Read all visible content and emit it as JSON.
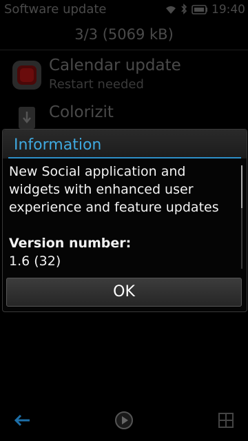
{
  "statusbar": {
    "title": "Software update",
    "time": "19:40",
    "icons": [
      "wifi-icon",
      "bluetooth-icon",
      "battery-icon"
    ]
  },
  "sub_header": {
    "summary": "3/3 (5069 kB)"
  },
  "updates": [
    {
      "name": "Calendar update",
      "status": "Restart needed",
      "icon": "calendar-app-icon"
    },
    {
      "name": "Colorizit",
      "status": "",
      "icon": "download-icon"
    }
  ],
  "dialog": {
    "title": "Information",
    "description": "New Social application and widgets with enhanced user experience and feature updates",
    "version_label": "Version number:",
    "version_value": "1.6 (32)",
    "ok_label": "OK"
  },
  "toolbar": {
    "icons": [
      "back-arrow-icon",
      "play-icon",
      "options-grid-icon"
    ]
  },
  "colors": {
    "accent": "#3fa9e0",
    "dialog_bg": "#050505",
    "background": "#000000"
  }
}
